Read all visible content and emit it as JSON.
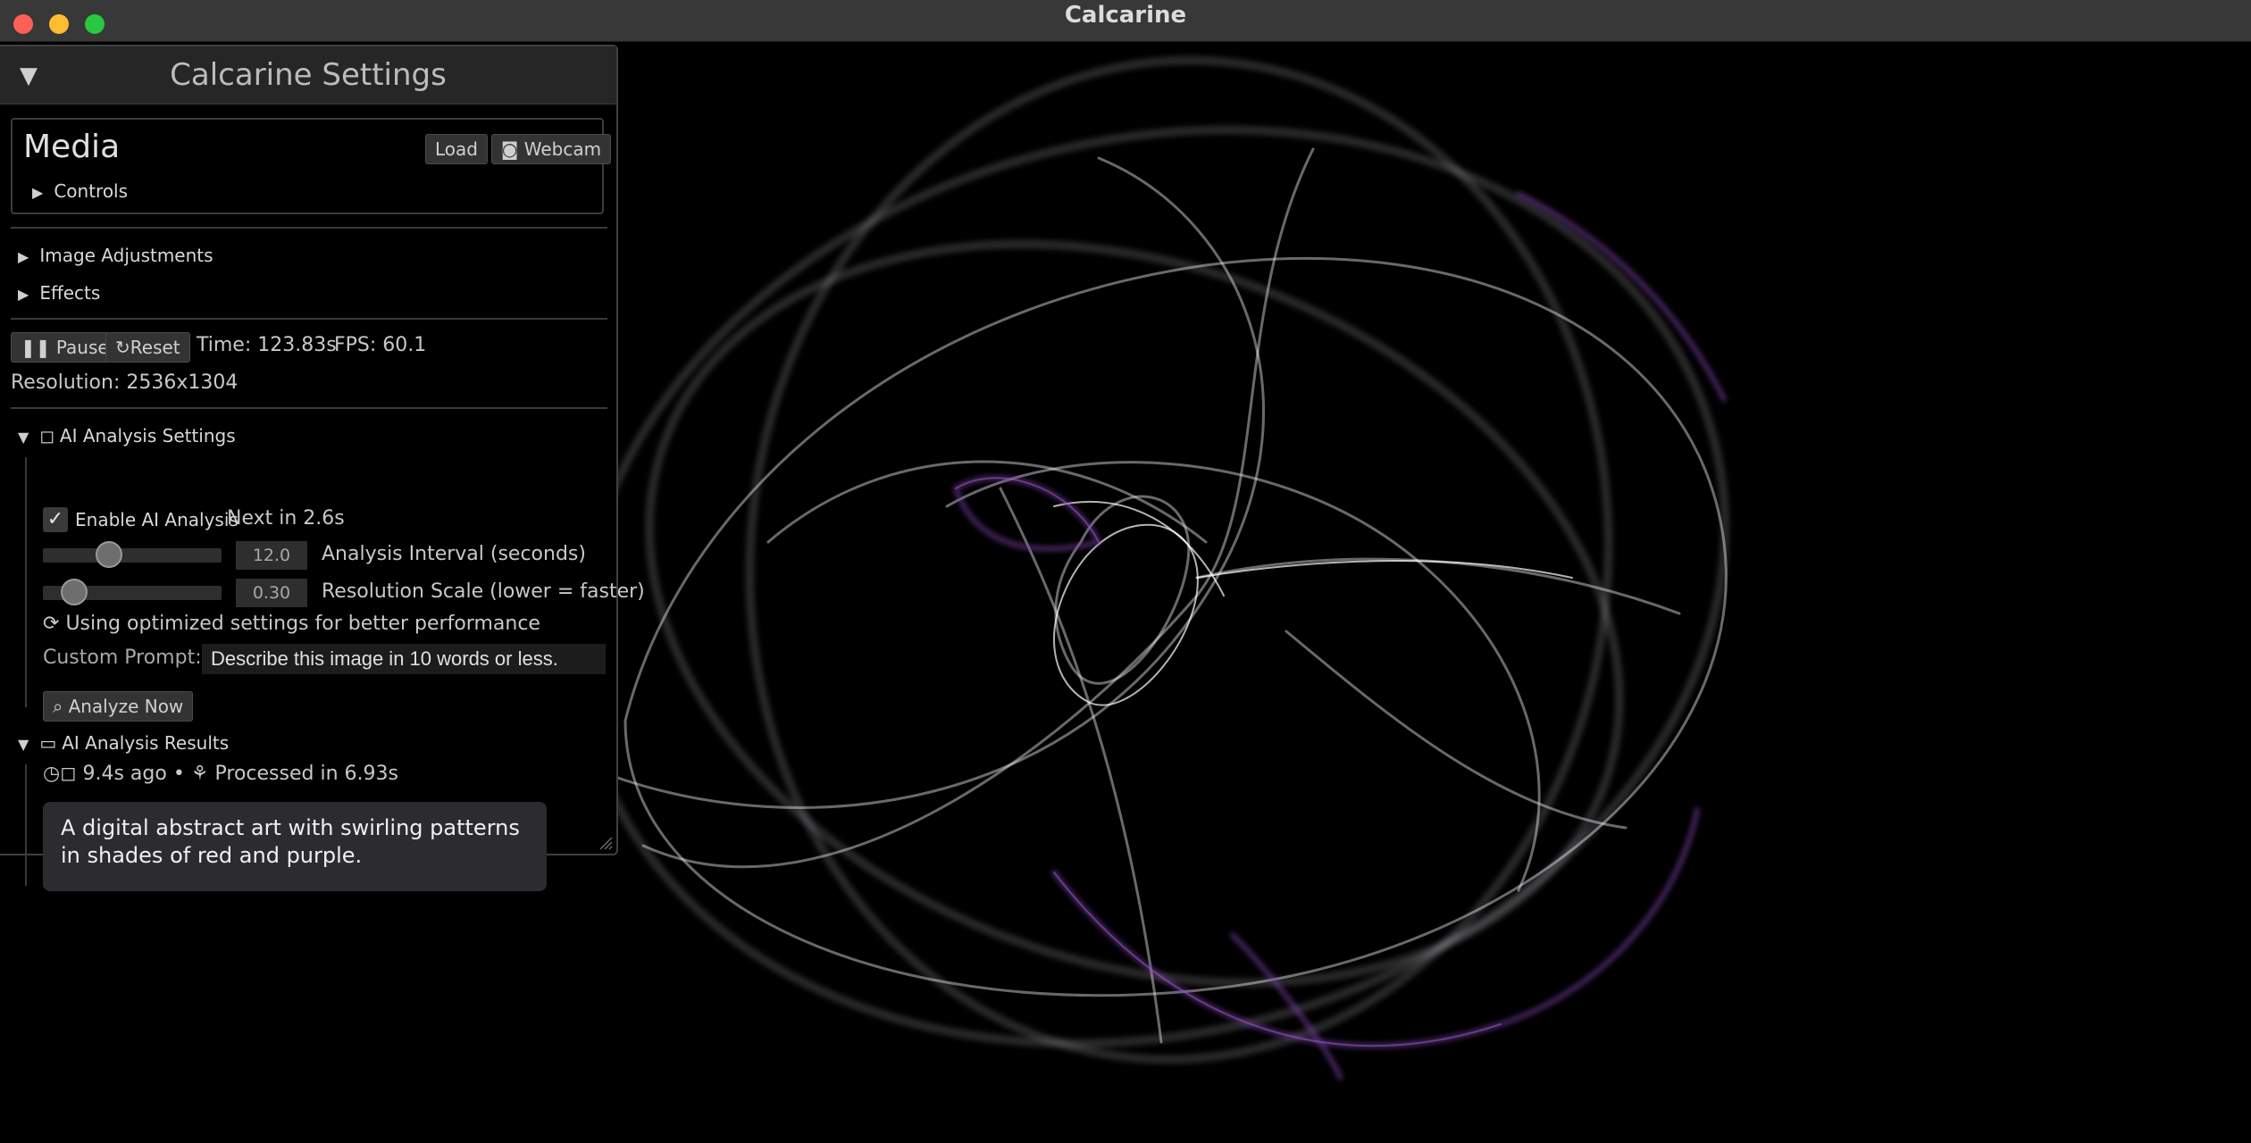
{
  "window": {
    "title": "Calcarine"
  },
  "panel": {
    "title": "Calcarine Settings",
    "media": {
      "title": "Media",
      "load_label": "Load",
      "webcam_label": "Webcam",
      "controls_label": "Controls"
    },
    "sections": {
      "image_adjustments": "Image Adjustments",
      "effects": "Effects"
    },
    "playback": {
      "pause_label": "Pause",
      "reset_label": "Reset",
      "time": "Time: 123.83s",
      "fps": "FPS: 60.1",
      "resolution": "Resolution: 2536x1304"
    },
    "ai_settings": {
      "header": "AI Analysis Settings",
      "enable_label": "Enable AI Analysis",
      "enabled": true,
      "next_in": "Next in 2.6s",
      "interval": {
        "value": "12.0",
        "label": "Analysis Interval (seconds)",
        "fraction": 0.35
      },
      "scale": {
        "value": "0.30",
        "label": "Resolution Scale (lower = faster)",
        "fraction": 0.12
      },
      "optimized_note": "Using optimized settings for better performance",
      "custom_prompt_label": "Custom Prompt:",
      "custom_prompt_value": "Describe this image in 10 words or less.",
      "analyze_label": "Analyze Now"
    },
    "ai_results": {
      "header": "AI Analysis Results",
      "meta_ago": "9.4s ago",
      "meta_processed": "Processed in 6.93s",
      "result_text": "A digital abstract art with swirling patterns in shades of red and purple."
    }
  },
  "colors": {
    "background": "#000000",
    "panel_header": "#262626",
    "accent_purple": "#7b3fa8",
    "curve_white": "#e6e6f0"
  }
}
